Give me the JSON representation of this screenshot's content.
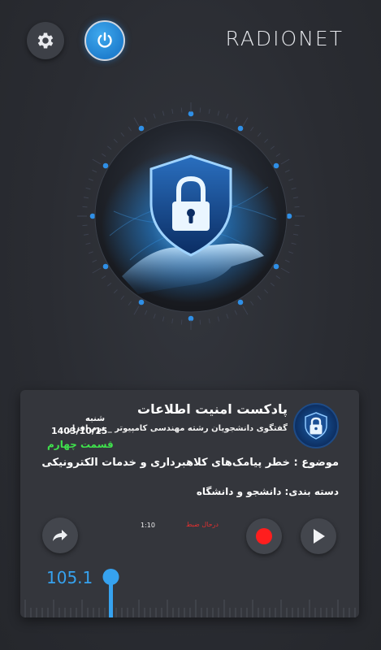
{
  "header": {
    "logo_text": "RADIONET",
    "settings_icon": "gear-icon",
    "power_icon": "power-icon"
  },
  "hero": {
    "image": "shield-lock-hand-illustration",
    "accent_color": "#2f8fe6"
  },
  "podcast": {
    "title": "پادکست امنیت اطلاعات",
    "subtitle": "گفتگوی دانشجویان رشته مهندسی کامپیوتر _ نرم افزار",
    "day": "شنبه",
    "date": "1403/10/15",
    "episode": "قسمت چهارم",
    "topic": "موضوع : خطر پیامک‌های کلاهبرداری و خدمات الکترونیکی",
    "category": "دسته بندی: دانشجو و دانشگاه",
    "thumbnail_icon": "padlock-icon"
  },
  "player": {
    "elapsed": "1:10",
    "record_status": "درحال ضبط",
    "share_icon": "share-icon",
    "record_icon": "record-icon",
    "play_icon": "play-icon",
    "record_color": "#ff1e1e"
  },
  "tuner": {
    "frequency": "105.1",
    "accent_color": "#36a2ef"
  }
}
